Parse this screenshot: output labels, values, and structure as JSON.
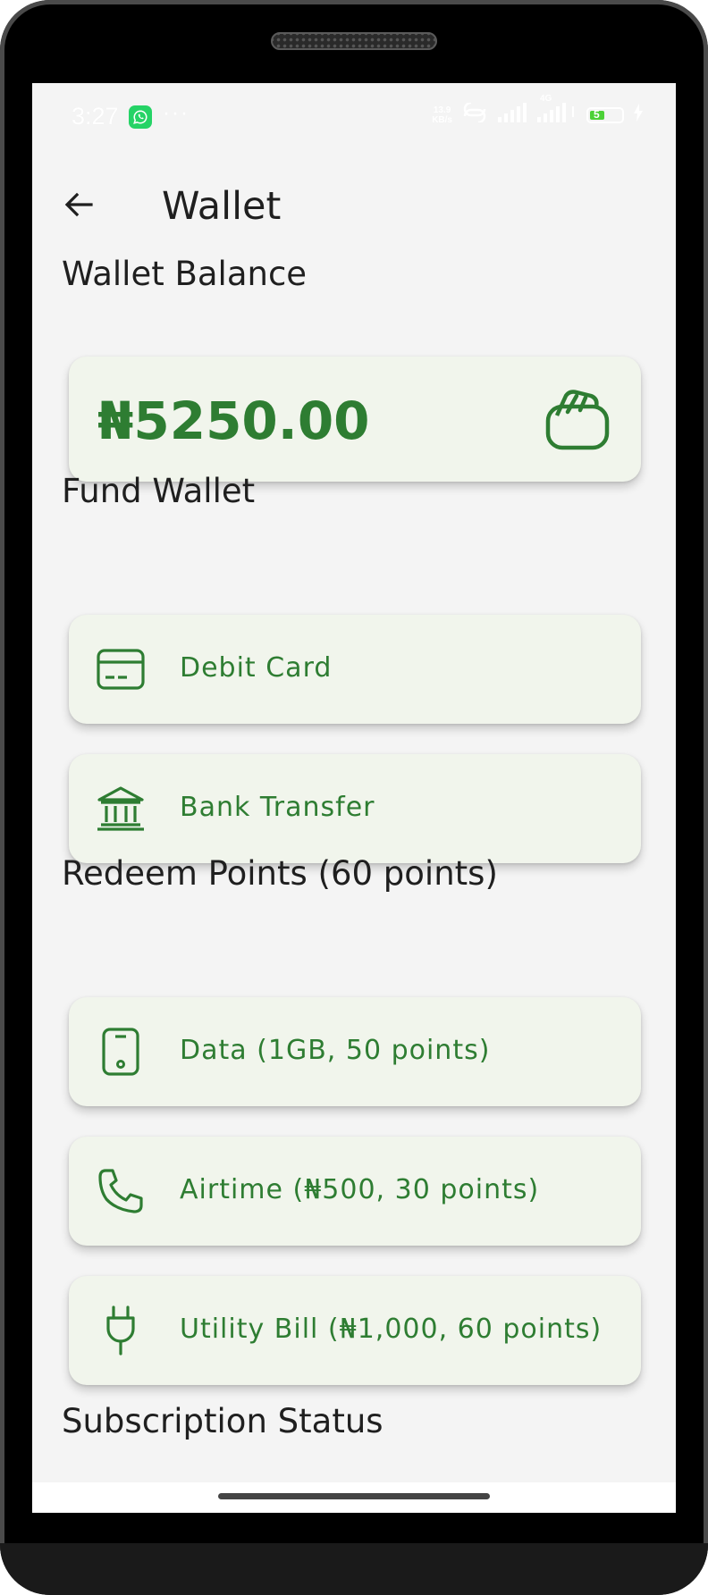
{
  "status_bar": {
    "time": "3:27",
    "more": "···",
    "net_speed_value": "13.9",
    "net_speed_unit": "KB/s",
    "network_type": "4G",
    "battery_level": "5"
  },
  "app_bar": {
    "title": "Wallet"
  },
  "balance": {
    "heading": "Wallet Balance",
    "amount": "₦5250.00"
  },
  "fund": {
    "heading": "Fund Wallet",
    "options": [
      {
        "label": "Debit Card",
        "icon": "credit-card-icon"
      },
      {
        "label": "Bank Transfer",
        "icon": "bank-icon"
      }
    ]
  },
  "redeem": {
    "heading": "Redeem Points (60 points)",
    "options": [
      {
        "label": "Data (1GB, 50 points)",
        "icon": "phone-icon"
      },
      {
        "label": "Airtime (₦500, 30 points)",
        "icon": "call-icon"
      },
      {
        "label": "Utility Bill (₦1,000, 60 points)",
        "icon": "plug-icon"
      }
    ]
  },
  "subscription": {
    "heading": "Subscription Status"
  },
  "colors": {
    "accent": "#2e7d32",
    "card_background": "#f1f5ec",
    "screen_background": "#f4f4f4"
  }
}
